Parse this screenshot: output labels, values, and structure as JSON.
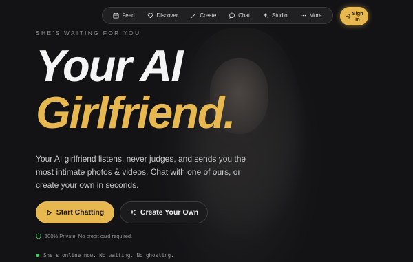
{
  "nav": {
    "items": [
      {
        "label": "Feed",
        "icon": "feed-icon"
      },
      {
        "label": "Discover",
        "icon": "heart-icon"
      },
      {
        "label": "Create",
        "icon": "wand-icon"
      },
      {
        "label": "Chat",
        "icon": "chat-bubble-icon"
      },
      {
        "label": "Studio",
        "icon": "sparkle-icon"
      },
      {
        "label": "More",
        "icon": "more-dots-icon"
      }
    ],
    "signin_label": "Sign in"
  },
  "hero": {
    "eyebrow": "SHE'S WAITING FOR YOU",
    "title_line1": "Your AI",
    "title_line2": "Girlfriend.",
    "description": "Your AI girlfriend listens, never judges, and sends you the most intimate photos & videos. Chat with one of ours, or create your own in seconds.",
    "primary_button": "Start Chatting",
    "secondary_button": "Create Your Own",
    "privacy_note": "100% Private. No credit card required.",
    "online_status": "She's online now. No waiting. No ghosting."
  },
  "colors": {
    "accent": "#e6b84f",
    "background": "#131316",
    "online_dot": "#3fcf6a"
  }
}
